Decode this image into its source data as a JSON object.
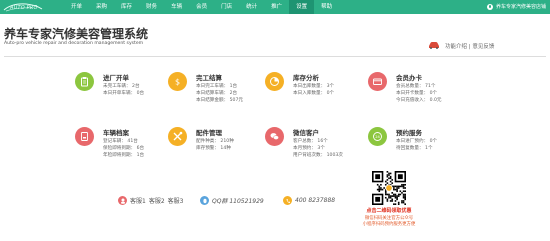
{
  "app": {
    "logo_text": "AUTO PRO",
    "shop_name": "养车专家汽修美容店铺"
  },
  "nav": [
    {
      "label": "开单",
      "active": false
    },
    {
      "label": "采购",
      "active": false
    },
    {
      "label": "库存",
      "active": false
    },
    {
      "label": "财务",
      "active": false
    },
    {
      "label": "车辆",
      "active": false
    },
    {
      "label": "会员",
      "active": false
    },
    {
      "label": "门店",
      "active": false
    },
    {
      "label": "统计",
      "active": false
    },
    {
      "label": "推广",
      "active": false
    },
    {
      "label": "设置",
      "active": true
    },
    {
      "label": "帮助",
      "active": false
    }
  ],
  "header": {
    "title": "养车专家汽修美容管理系统",
    "subtitle": "Auto-pro vehicle repair and decoration management system",
    "help_text": "功能介绍 | 意见反馈"
  },
  "modules": [
    {
      "name": "进厂开单",
      "icon": "clipboard-icon",
      "color": "#8cc63f",
      "lines": [
        "未完工车辆： 2台",
        "本日开单车辆： 0台"
      ]
    },
    {
      "name": "完工结算",
      "icon": "dollar-icon",
      "color": "#f5b025",
      "lines": [
        "本日完工车辆： 1台",
        "本日结算车辆： 2台",
        "本日结算金额： 507元"
      ]
    },
    {
      "name": "库存分析",
      "icon": "pie-chart-icon",
      "color": "#f5b025",
      "lines": [
        "本日出库数量： 3个",
        "本日入库数量： 0个"
      ]
    },
    {
      "name": "会员办卡",
      "icon": "card-icon",
      "color": "#e8686b",
      "lines": [
        "会员总数量： 71个",
        "本日开卡数量： 0个",
        "今日充值收入： 0.0元"
      ]
    },
    {
      "name": "车辆档案",
      "icon": "car-file-icon",
      "color": "#e8686b",
      "lines": [
        "登记车辆： 41台",
        "保险即将到期： 6台",
        "年检即将到期： 1台"
      ]
    },
    {
      "name": "配件管理",
      "icon": "tools-icon",
      "color": "#f5b025",
      "lines": [
        "配件种类： 210种",
        "库存预警： 14种"
      ]
    },
    {
      "name": "微信客户",
      "icon": "wechat-icon",
      "color": "#e8686b",
      "lines": [
        "客户总数： 16个",
        "本月预约： 3个",
        "用户背班次数： 1003次"
      ]
    },
    {
      "name": "预约服务",
      "icon": "calendar-24-icon",
      "color": "#8cc63f",
      "lines": [
        "本日进厂预约： 0个",
        "待回复数量： 1个"
      ]
    }
  ],
  "contacts": {
    "kefu": [
      "客服1",
      "客服2",
      "客服3"
    ],
    "qq": "QQ群 110521929",
    "phone": "400 8237888"
  },
  "promo": {
    "line1": "点击二维码领取优惠",
    "line2": "微信扫码关注官方公众号",
    "line3": "小程序扫码预约服务更方便"
  }
}
